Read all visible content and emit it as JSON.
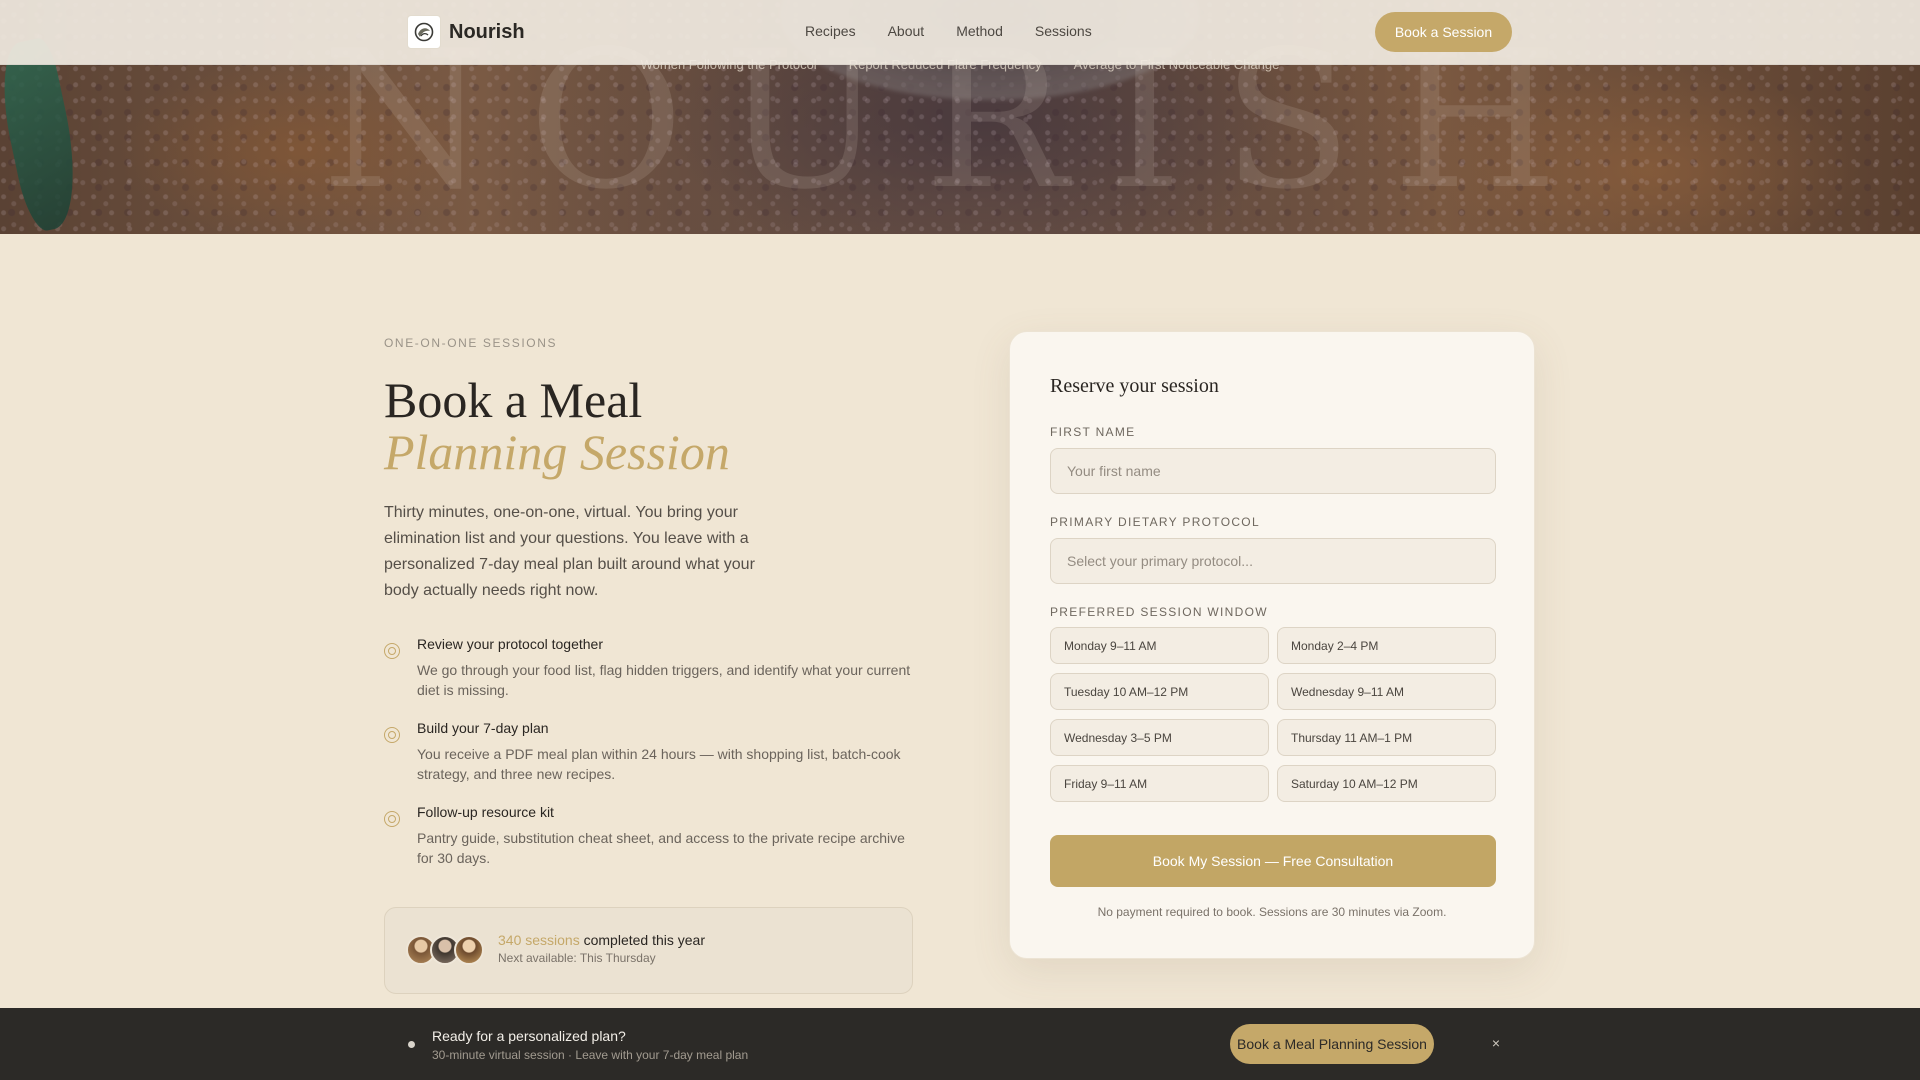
{
  "header": {
    "brand": "Nourish",
    "logo_icon": "leaf-swirl-icon",
    "nav": [
      "Recipes",
      "About",
      "Method",
      "Sessions"
    ],
    "cta_label": "Book a Session"
  },
  "hero": {
    "watermark": "NOURISH",
    "stats": [
      "Women Following the Protocol",
      "Report Reduced Flare Frequency",
      "Average to First Noticeable Change"
    ]
  },
  "intro": {
    "eyebrow": "ONE-ON-ONE SESSIONS",
    "title_line1": "Book a Meal",
    "title_line2": "Planning Session",
    "description": "Thirty minutes, one-on-one, virtual. You bring your elimination list and your questions. You leave with a personalized 7-day meal plan built around what your body actually needs right now."
  },
  "features": [
    {
      "icon": "target-circle-icon",
      "title": "Review your protocol together",
      "description": "We go through your food list, flag hidden triggers, and identify what your current diet is missing."
    },
    {
      "icon": "target-circle-icon",
      "title": "Build your 7-day plan",
      "description": "You receive a PDF meal plan within 24 hours — with shopping list, batch-cook strategy, and three new recipes."
    },
    {
      "icon": "target-circle-icon",
      "title": "Follow-up resource kit",
      "description": "Pantry guide, substitution cheat sheet, and access to the private recipe archive for 30 days."
    }
  ],
  "social_proof": {
    "count": "340 sessions",
    "count_suffix": " completed this year",
    "next": "Next available: This Thursday"
  },
  "form": {
    "title": "Reserve your session",
    "first_name_label": "FIRST NAME",
    "first_name_placeholder": "Your first name",
    "protocol_label": "PRIMARY DIETARY PROTOCOL",
    "protocol_placeholder": "Select your primary protocol...",
    "window_label": "PREFERRED SESSION WINDOW",
    "slots": [
      "Monday 9–11 AM",
      "Monday 2–4 PM",
      "Tuesday 10 AM–12 PM",
      "Wednesday 9–11 AM",
      "Wednesday 3–5 PM",
      "Thursday 11 AM–1 PM",
      "Friday 9–11 AM",
      "Saturday 10 AM–12 PM"
    ],
    "submit_label": "Book My Session — Free Consultation",
    "fine_print": "No payment required to book. Sessions are 30 minutes via Zoom."
  },
  "bottom_bar": {
    "title": "Ready for a personalized plan?",
    "subtitle": "30-minute virtual session · Leave with your 7-day meal plan",
    "cta_label": "Book a Meal Planning Session",
    "close_glyph": "×"
  },
  "colors": {
    "accent": "#c5a869",
    "background": "#f0e6d4",
    "card": "#faf6ef",
    "dark_bar": "#2c2a27"
  }
}
